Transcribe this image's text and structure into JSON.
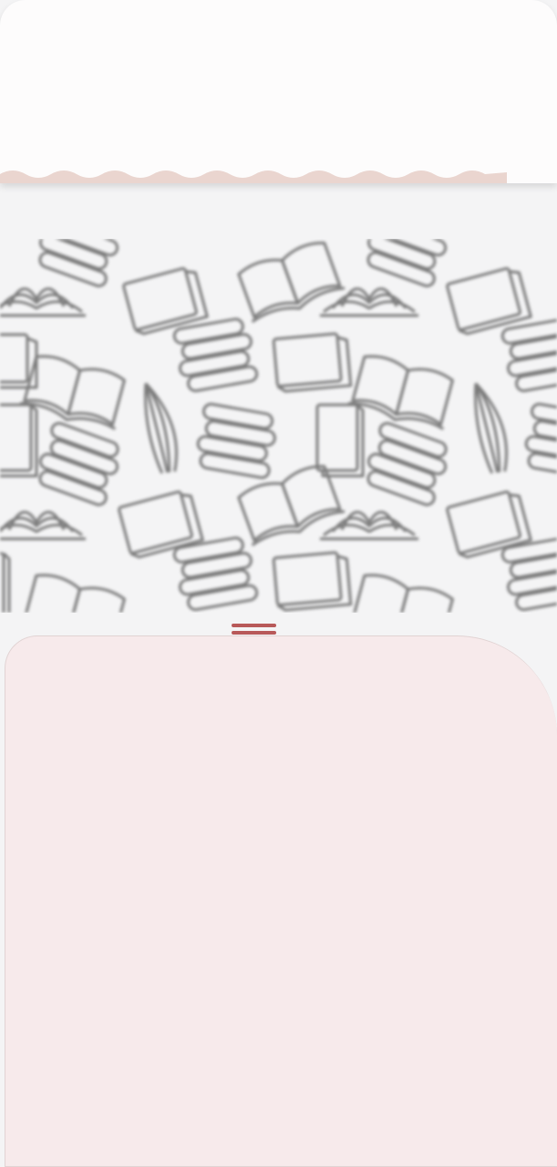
{
  "header": {
    "background_color": "#fdfcfc",
    "wave_color": "#ead5cf"
  },
  "pattern": {
    "description_icons": [
      "open-book-icon",
      "closed-book-icon",
      "book-stack-icon",
      "standing-book-icon"
    ],
    "stroke_color": "#8a8a8a"
  },
  "drag_handle": {
    "icon": "drag-handle-icon",
    "color": "#b85959"
  },
  "bottom_sheet": {
    "background_color": "#f7eaeb",
    "border_color": "#e1d3d3"
  }
}
